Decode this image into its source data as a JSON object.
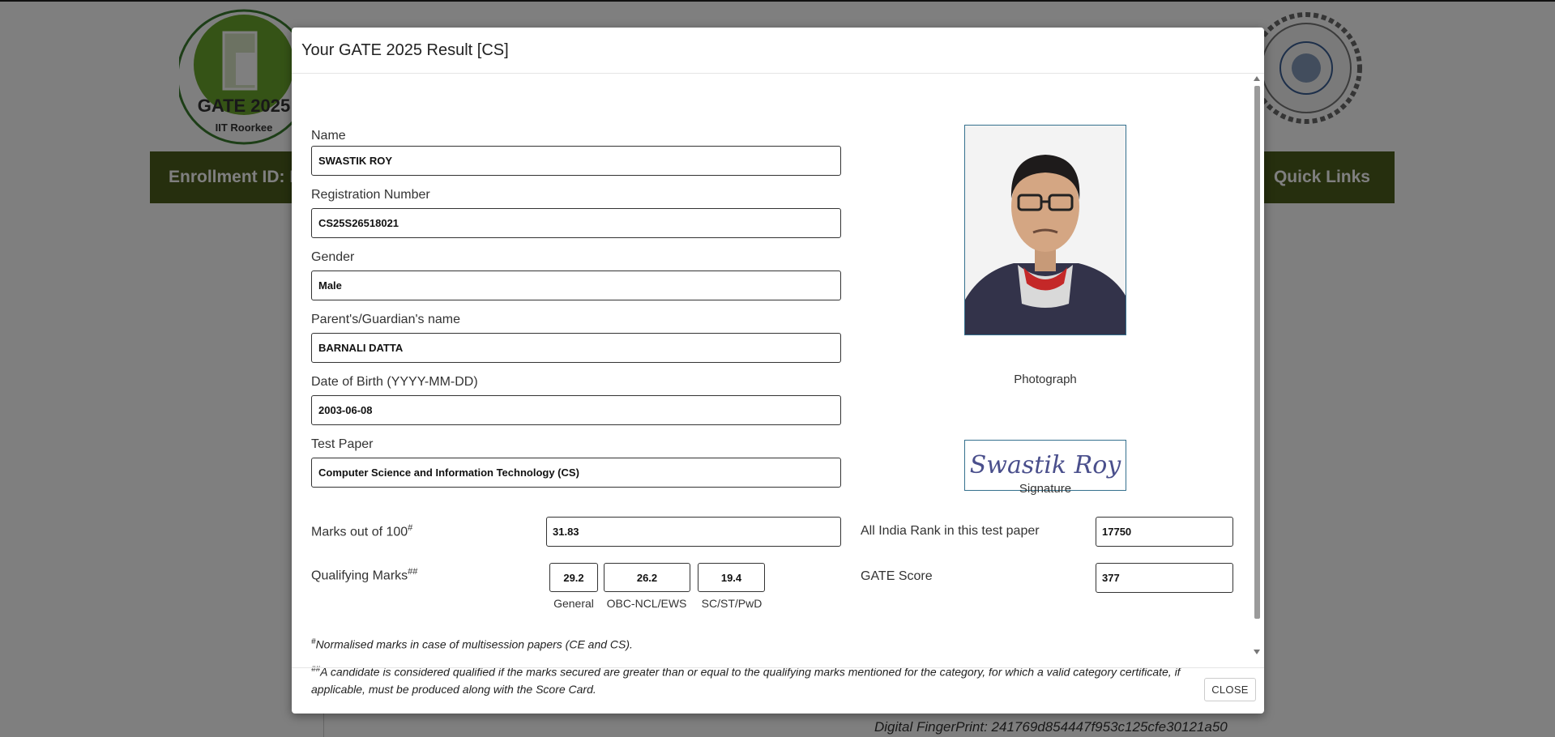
{
  "background": {
    "logo_left": {
      "line1": "GATE 2025",
      "line2": "IIT Roorkee"
    },
    "nav": {
      "enrollment": "Enrollment ID: F",
      "quick_links": "Quick Links"
    },
    "fingerprint": "Digital FingerPrint: 241769d854447f953c125cfe30121a50"
  },
  "modal": {
    "title": "Your GATE 2025 Result [CS]",
    "fields": {
      "name": {
        "label": "Name",
        "value": "SWASTIK ROY"
      },
      "registration": {
        "label": "Registration Number",
        "value": "CS25S26518021"
      },
      "gender": {
        "label": "Gender",
        "value": "Male"
      },
      "guardian": {
        "label": "Parent's/Guardian's name",
        "value": "BARNALI DATTA"
      },
      "dob": {
        "label": "Date of Birth (YYYY-MM-DD)",
        "value": "2003-06-08"
      },
      "test_paper": {
        "label": "Test Paper",
        "value": "Computer Science and Information Technology (CS)"
      }
    },
    "photo_caption": "Photograph",
    "signature": {
      "caption": "Signature",
      "text": "Swastik Roy"
    },
    "marks": {
      "label": "Marks out of 100",
      "sup": "#",
      "value": "31.83"
    },
    "rank": {
      "label": "All India Rank in this test paper",
      "value": "17750"
    },
    "qualifying": {
      "label": "Qualifying Marks",
      "sup": "##",
      "general": {
        "value": "29.2",
        "caption": "General"
      },
      "obc": {
        "value": "26.2",
        "caption": "OBC-NCL/EWS"
      },
      "sc": {
        "value": "19.4",
        "caption": "SC/ST/PwD"
      }
    },
    "score": {
      "label": "GATE Score",
      "value": "377"
    },
    "notes": {
      "note1_sup": "#",
      "note1": "Normalised marks in case of multisession papers (CE and CS).",
      "note2_sup": "##",
      "note2": "A candidate is considered qualified if the marks secured are greater than or equal to the qualifying marks mentioned for the category, for which a valid category certificate, if applicable, must be produced along with the Score Card."
    },
    "close_label": "CLOSE"
  },
  "colors": {
    "nav": "#4d5f1d",
    "frame_border": "#35708e",
    "overlay": "rgba(0,0,0,0.5)"
  }
}
